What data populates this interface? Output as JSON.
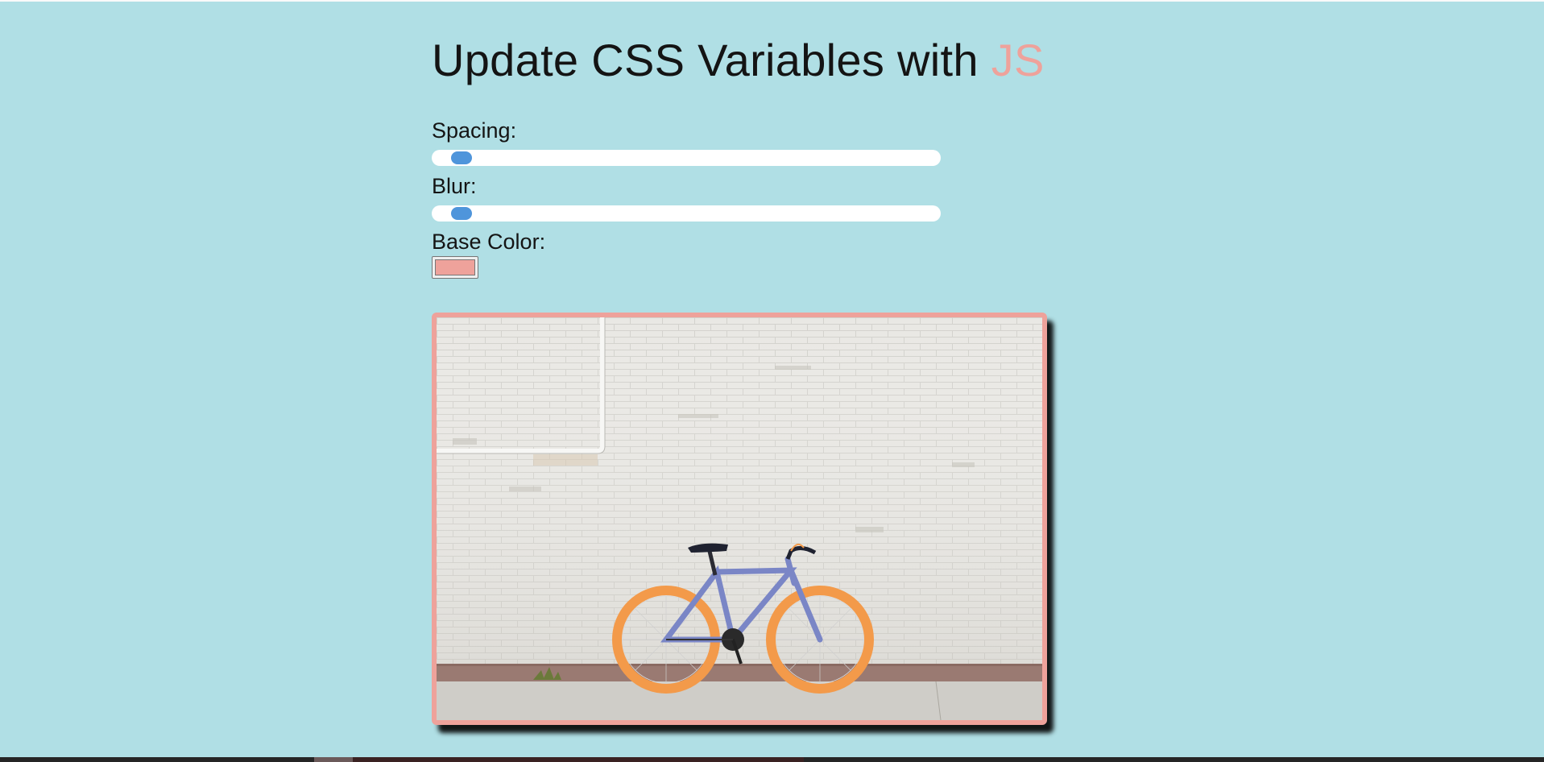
{
  "page": {
    "title_prefix": "Update CSS Variables with ",
    "title_highlight": "JS"
  },
  "controls": {
    "spacing": {
      "label": "Spacing:",
      "value_fraction": 0.04
    },
    "blur": {
      "label": "Blur:",
      "value_fraction": 0.04
    },
    "base_color": {
      "label": "Base Color:",
      "value": "#eea29b"
    }
  },
  "colors": {
    "background": "#b0dfe5",
    "accent": "#eea29b",
    "slider_thumb": "#4a90e2"
  },
  "image": {
    "subject": "bicycle-leaning-on-white-brick-wall"
  }
}
